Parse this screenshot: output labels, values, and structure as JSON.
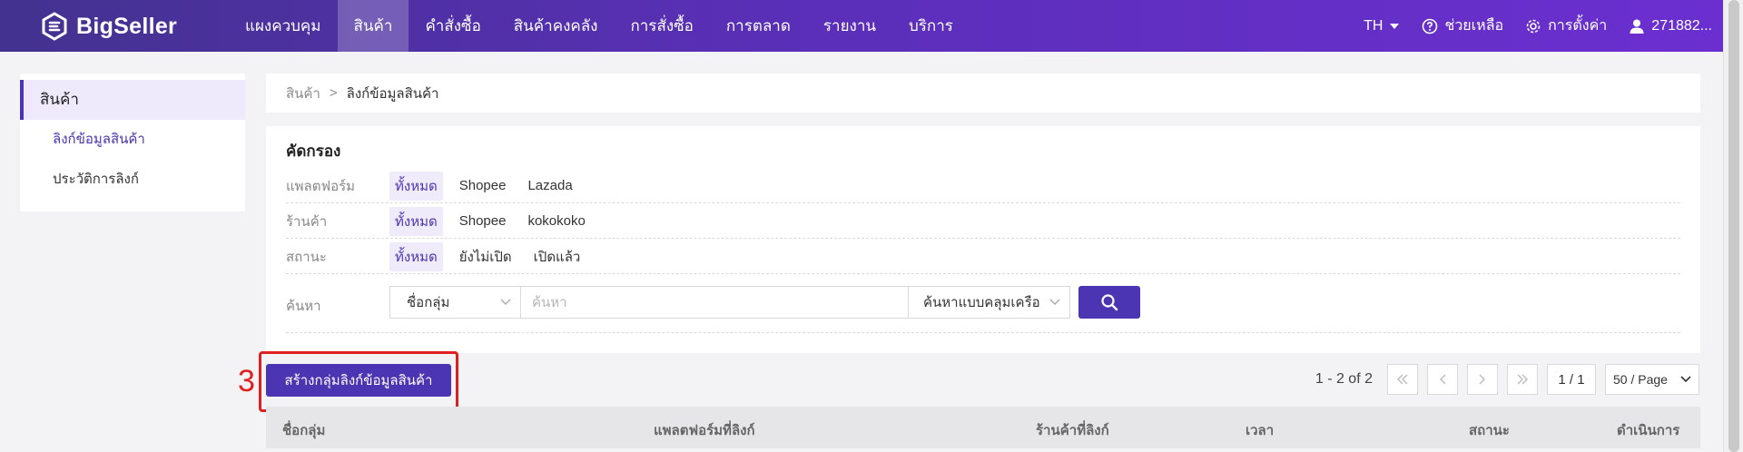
{
  "brand": {
    "name": "BigSeller"
  },
  "nav": {
    "items": [
      {
        "label": "แผงควบคุม"
      },
      {
        "label": "สินค้า",
        "active": true
      },
      {
        "label": "คำสั่งซื้อ"
      },
      {
        "label": "สินค้าคงคลัง"
      },
      {
        "label": "การสั่งซื้อ"
      },
      {
        "label": "การตลาด"
      },
      {
        "label": "รายงาน"
      },
      {
        "label": "บริการ"
      }
    ],
    "language": "TH",
    "help": "ช่วยเหลือ",
    "settings": "การตั้งค่า",
    "user": "271882..."
  },
  "sidebar": {
    "header": "สินค้า",
    "items": [
      {
        "label": "ลิงก์ข้อมูลสินค้า",
        "active": true
      },
      {
        "label": "ประวัติการลิงก์"
      }
    ]
  },
  "breadcrumb": {
    "root": "สินค้า",
    "separator": ">",
    "current": "ลิงก์ข้อมูลสินค้า"
  },
  "filter": {
    "title": "คัดกรอง",
    "platform": {
      "label": "แพลตฟอร์ม",
      "options": [
        "ทั้งหมด",
        "Shopee",
        "Lazada"
      ]
    },
    "store": {
      "label": "ร้านค้า",
      "options": [
        "ทั้งหมด",
        "Shopee",
        "kokokoko"
      ]
    },
    "status": {
      "label": "สถานะ",
      "options": [
        "ทั้งหมด",
        "ยังไม่เปิด",
        "เปิดแล้ว"
      ]
    },
    "search": {
      "label": "ค้นหา",
      "field_select": "ชื่อกลุ่ม",
      "placeholder": "ค้นหา",
      "value": "",
      "mode_select": "ค้นหาแบบคลุมเครือ"
    }
  },
  "annotation": {
    "number": "3"
  },
  "actions": {
    "create_label": "สร้างกลุ่มลิงก์ข้อมูลสินค้า"
  },
  "pagination": {
    "range": "1 - 2 of 2",
    "page": "1 / 1",
    "page_size": "50 / Page"
  },
  "table": {
    "columns": [
      "ชื่อกลุ่ม",
      "แพลตฟอร์มที่ลิงก์",
      "ร้านค้าที่ลิงก์",
      "เวลา",
      "สถานะ",
      "ดำเนินการ"
    ]
  },
  "colors": {
    "primary": "#4b35b2",
    "annotation": "#e02020"
  }
}
